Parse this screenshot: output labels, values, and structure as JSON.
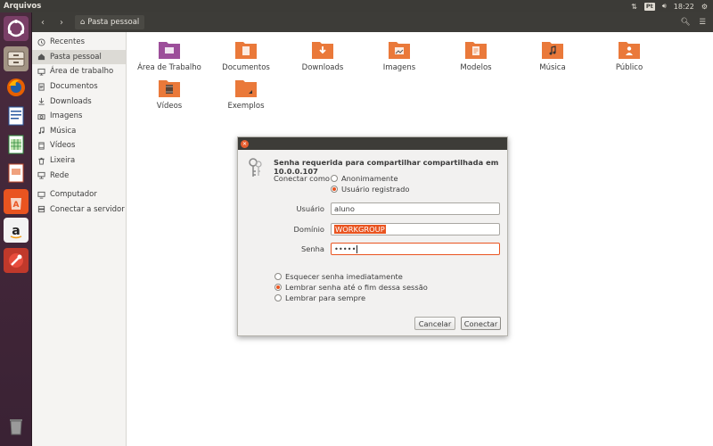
{
  "panel": {
    "app_title": "Arquivos",
    "keyboard_layout": "Pt",
    "clock": "18:22"
  },
  "header": {
    "breadcrumb": "Pasta pessoal"
  },
  "sidebar": {
    "items": [
      {
        "label": "Recentes",
        "icon": "clock-icon"
      },
      {
        "label": "Pasta pessoal",
        "icon": "home-icon"
      },
      {
        "label": "Área de trabalho",
        "icon": "desktop-icon"
      },
      {
        "label": "Documentos",
        "icon": "document-icon"
      },
      {
        "label": "Downloads",
        "icon": "download-icon"
      },
      {
        "label": "Imagens",
        "icon": "camera-icon"
      },
      {
        "label": "Música",
        "icon": "music-icon"
      },
      {
        "label": "Vídeos",
        "icon": "film-icon"
      },
      {
        "label": "Lixeira",
        "icon": "trash-icon"
      },
      {
        "label": "Rede",
        "icon": "network-icon"
      }
    ],
    "devices": [
      {
        "label": "Computador",
        "icon": "computer-icon"
      },
      {
        "label": "Conectar a servidor",
        "icon": "server-icon"
      }
    ]
  },
  "folders": [
    {
      "label": "Área de Trabalho",
      "icon": "desktop-folder-icon",
      "color": "#9c4e9a"
    },
    {
      "label": "Documentos",
      "icon": "documents-folder-icon",
      "color": "#e9793a"
    },
    {
      "label": "Downloads",
      "icon": "downloads-folder-icon",
      "color": "#e9793a"
    },
    {
      "label": "Imagens",
      "icon": "pictures-folder-icon",
      "color": "#e9793a"
    },
    {
      "label": "Modelos",
      "icon": "templates-folder-icon",
      "color": "#e9793a"
    },
    {
      "label": "Música",
      "icon": "music-folder-icon",
      "color": "#e9793a"
    },
    {
      "label": "Público",
      "icon": "public-folder-icon",
      "color": "#e9793a"
    },
    {
      "label": "Vídeos",
      "icon": "videos-folder-icon",
      "color": "#e9793a"
    },
    {
      "label": "Exemplos",
      "icon": "examples-folder-icon",
      "color": "#e9793a"
    }
  ],
  "dialog": {
    "heading": "Senha requerida para compartilhar compartilhada em 10.0.0.107",
    "connect_as_label": "Conectar como",
    "connect_options": [
      {
        "label": "Anonimamente",
        "selected": false
      },
      {
        "label": "Usuário registrado",
        "selected": true
      }
    ],
    "fields": {
      "username_label": "Usuário",
      "username_value": "aluno",
      "domain_label": "Domínio",
      "domain_value": "WORKGROUP",
      "password_label": "Senha",
      "password_value": "•••••"
    },
    "remember_options": [
      {
        "label": "Esquecer senha imediatamente",
        "selected": false
      },
      {
        "label": "Lembrar senha até o fim dessa sessão",
        "selected": true
      },
      {
        "label": "Lembrar para sempre",
        "selected": false
      }
    ],
    "cancel_label": "Cancelar",
    "connect_label": "Conectar"
  },
  "colors": {
    "accent": "#e95420",
    "panel": "#3c3b37",
    "launcher": "#4a2b3e",
    "folder": "#e9793a"
  }
}
